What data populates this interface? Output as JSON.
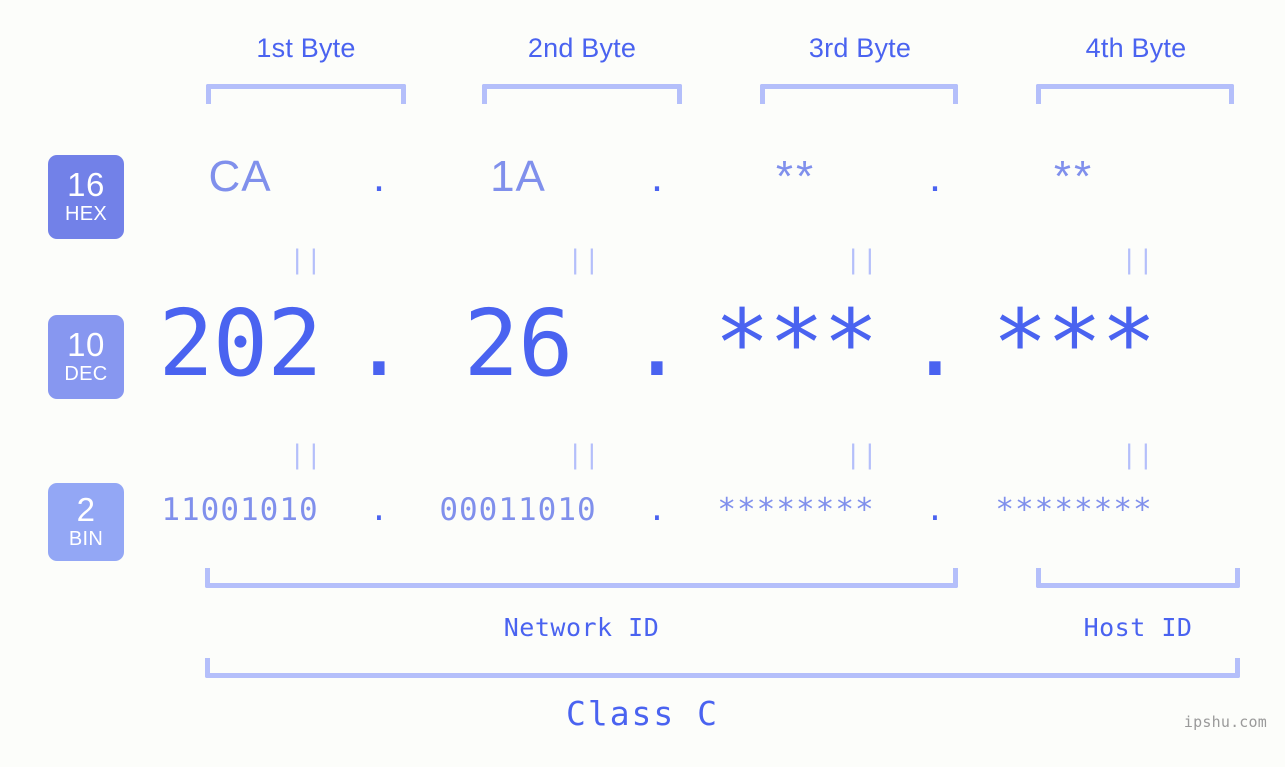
{
  "background_color": "#fcfdfa",
  "accent_color": "#4a63f0",
  "accent_light_color": "#8090ec",
  "bracket_color": "#b4bffa",
  "byte_headers": [
    {
      "label": "1st Byte"
    },
    {
      "label": "2nd Byte"
    },
    {
      "label": "3rd Byte"
    },
    {
      "label": "4th Byte"
    }
  ],
  "radix_badges": [
    {
      "number": "16",
      "abbr": "HEX",
      "color": "#7281e8"
    },
    {
      "number": "10",
      "abbr": "DEC",
      "color": "#8797f0"
    },
    {
      "number": "2",
      "abbr": "BIN",
      "color": "#93a7f5"
    }
  ],
  "separator_dot": ".",
  "equals_symbol": "||",
  "rows": {
    "hex": {
      "values": [
        "CA",
        "1A",
        "**",
        "**"
      ]
    },
    "dec": {
      "values": [
        "202",
        "26",
        "***",
        "***"
      ]
    },
    "bin": {
      "values": [
        "11001010",
        "00011010",
        "********",
        "********"
      ]
    }
  },
  "segments": {
    "network_id": "Network ID",
    "host_id": "Host ID"
  },
  "class_label": "Class C",
  "watermark": "ipshu.com"
}
